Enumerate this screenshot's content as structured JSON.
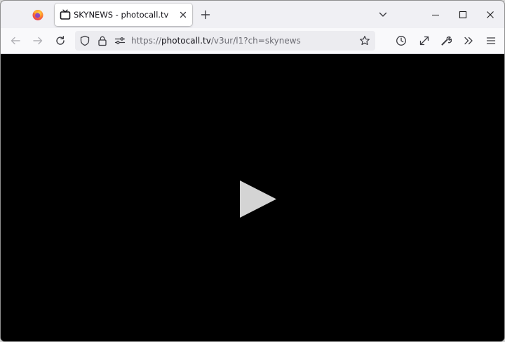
{
  "colors": {
    "tabstrip_bg": "#f0f0f4",
    "toolbar_bg": "#f9f9fb",
    "urlbar_bg": "#ececf0",
    "content_bg": "#000000",
    "play_icon": "#d4d4d4",
    "icon_color": "#5b5b66"
  },
  "tabs": [
    {
      "title": "SKYNEWS - photocall.tv",
      "favicon": "tv-icon",
      "active": true
    }
  ],
  "url": {
    "scheme": "https://",
    "host": "photocall.tv",
    "path": "/v3ur/l1?ch=skynews"
  },
  "icons": {
    "browser_logo": "firefox-logo-icon",
    "close_tab": "close-icon",
    "new_tab": "plus-icon",
    "tab_list": "chevron-down-icon",
    "minimize": "minimize-icon",
    "maximize": "maximize-icon",
    "close_window": "close-icon",
    "back": "arrow-left-icon",
    "forward": "arrow-right-icon",
    "reload": "reload-icon",
    "tracking_protection": "shield-icon",
    "secure": "lock-icon",
    "permissions": "sliders-icon",
    "bookmark": "star-icon",
    "history": "clock-icon",
    "fullscreen": "expand-icon",
    "tools": "wrench-icon",
    "overflow": "double-chevron-right-icon",
    "menu": "hamburger-icon",
    "player": "play-icon"
  }
}
